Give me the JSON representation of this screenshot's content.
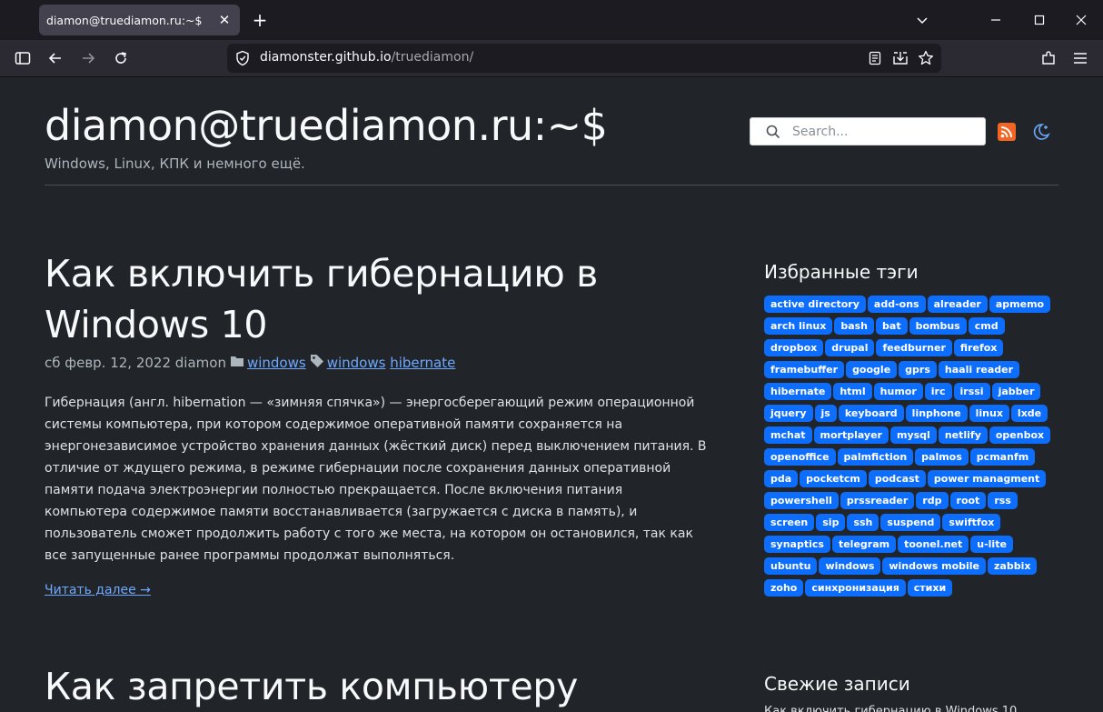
{
  "browser": {
    "tab_title": "diamon@truediamon.ru:~$",
    "url_domain": "diamonster.github.io",
    "url_path": "/truediamon/"
  },
  "site": {
    "title": "diamon@truediamon.ru:~$",
    "description": "Windows, Linux, КПК и немного ещё.",
    "search_placeholder": "Search..."
  },
  "post": {
    "title": "Как включить гибернацию в Windows 10",
    "date_author": "сб февр. 12, 2022 diamon",
    "category": "windows",
    "tags": [
      "windows",
      "hibernate"
    ],
    "body": "Гибернация (англ. hibernation — «зимняя спячка») — энергосберегающий режим операционной системы компьютера, при котором содержимое оперативной памяти сохраняется на энергонезависимое устройство хранения данных (жёсткий диск) перед выключением питания. В отличие от ждущего режима, в режиме гибернации после сохранения данных оперативной памяти подача электроэнергии полностью прекращается. После включения питания компьютера содержимое памяти восстанавливается (загружается с диска в память), и пользователь сможет продолжить работу с того же места, на котором он остановился, так как все запущенные ранее программы продолжат выполняться.",
    "read_more": "Читать далее →"
  },
  "post2": {
    "title": "Как запретить компьютеру"
  },
  "sidebar": {
    "tags_heading": "Избранные тэги",
    "tags": [
      "active directory",
      "add-ons",
      "alreader",
      "apmemo",
      "arch linux",
      "bash",
      "bat",
      "bombus",
      "cmd",
      "dropbox",
      "drupal",
      "feedburner",
      "firefox",
      "framebuffer",
      "google",
      "gprs",
      "haali reader",
      "hibernate",
      "html",
      "humor",
      "irc",
      "irssi",
      "jabber",
      "jquery",
      "js",
      "keyboard",
      "linphone",
      "linux",
      "lxde",
      "mchat",
      "mortplayer",
      "mysql",
      "netlify",
      "openbox",
      "openoffice",
      "palmfiction",
      "palmos",
      "pcmanfm",
      "pda",
      "pocketcm",
      "podcast",
      "power managment",
      "powershell",
      "prssreader",
      "rdp",
      "root",
      "rss",
      "screen",
      "sip",
      "ssh",
      "suspend",
      "swiftfox",
      "synaptics",
      "telegram",
      "toonel.net",
      "u-lite",
      "ubuntu",
      "windows",
      "windows mobile",
      "zabbix",
      "zoho",
      "синхронизация",
      "стихи"
    ],
    "recent_heading": "Свежие записи",
    "recent_first": "Как включить гибернацию в Windows 10"
  },
  "colors": {
    "page_bg": "#212529",
    "tag_bg": "#0d6efd",
    "link": "#6ea8fe",
    "rss": "#f26522"
  }
}
